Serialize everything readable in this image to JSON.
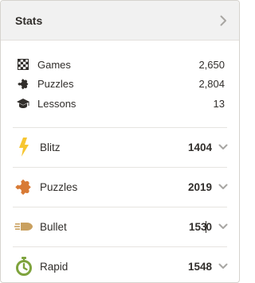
{
  "header": {
    "title": "Stats",
    "chevron_icon": "chevron-right-icon"
  },
  "summary": [
    {
      "key": "games",
      "icon": "chessboard-icon",
      "label": "Games",
      "value": "2,650"
    },
    {
      "key": "puzzles",
      "icon": "puzzle-piece-icon",
      "label": "Puzzles",
      "value": "2,804"
    },
    {
      "key": "lessons",
      "icon": "graduation-cap-icon",
      "label": "Lessons",
      "value": "13"
    }
  ],
  "ratings": [
    {
      "key": "blitz",
      "icon": "lightning-icon",
      "color": "#f7c631",
      "label": "Blitz",
      "value": "1404"
    },
    {
      "key": "puzzles",
      "icon": "puzzle-piece-icon",
      "color": "#d87a35",
      "label": "Puzzles",
      "value": "2019"
    },
    {
      "key": "bullet",
      "icon": "bullet-icon",
      "color": "#c9a05f",
      "label": "Bullet",
      "value_before_cursor": "153",
      "value_after_cursor": "0"
    },
    {
      "key": "rapid",
      "icon": "stopwatch-icon",
      "color": "#7ea33d",
      "label": "Rapid",
      "value": "1548"
    }
  ],
  "colors": {
    "text": "#312e2b",
    "muted_icon": "#a8a6a3",
    "header_bg": "#f1f1f1",
    "divider": "#e6e4e0"
  }
}
